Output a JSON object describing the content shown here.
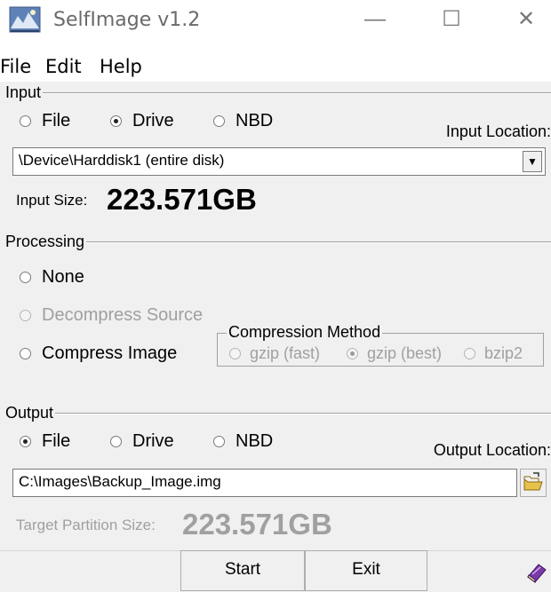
{
  "window": {
    "title": "SelfImage v1.2",
    "minimize": "—",
    "maximize": "☐",
    "close": "✕"
  },
  "menu": {
    "items": [
      "File",
      "Edit",
      "Help"
    ]
  },
  "input": {
    "group_label": "Input",
    "sources": [
      {
        "label": "File",
        "selected": false
      },
      {
        "label": "Drive",
        "selected": true
      },
      {
        "label": "NBD",
        "selected": false
      }
    ],
    "location_label": "Input Location:",
    "location_value": "\\Device\\Harddisk1 (entire disk)",
    "size_label": "Input Size:",
    "size_value": "223.571GB"
  },
  "processing": {
    "group_label": "Processing",
    "none_label": "None",
    "decompress_label": "Decompress Source",
    "compress_label": "Compress Image",
    "compression_group_label": "Compression Method",
    "methods": [
      {
        "label": "gzip (fast)",
        "selected": false
      },
      {
        "label": "gzip (best)",
        "selected": true
      },
      {
        "label": "bzip2",
        "selected": false
      }
    ]
  },
  "output": {
    "group_label": "Output",
    "targets": [
      {
        "label": "File",
        "selected": true
      },
      {
        "label": "Drive",
        "selected": false
      },
      {
        "label": "NBD",
        "selected": false
      }
    ],
    "location_label": "Output Location:",
    "location_value": "C:\\Images\\Backup_Image.img",
    "target_size_label": "Target Partition Size:",
    "target_size_value": "223.571GB"
  },
  "buttons": {
    "start": "Start",
    "exit": "Exit"
  },
  "icons": {
    "app": "drive-image-icon",
    "browse": "open-folder-icon",
    "help": "book-icon"
  }
}
